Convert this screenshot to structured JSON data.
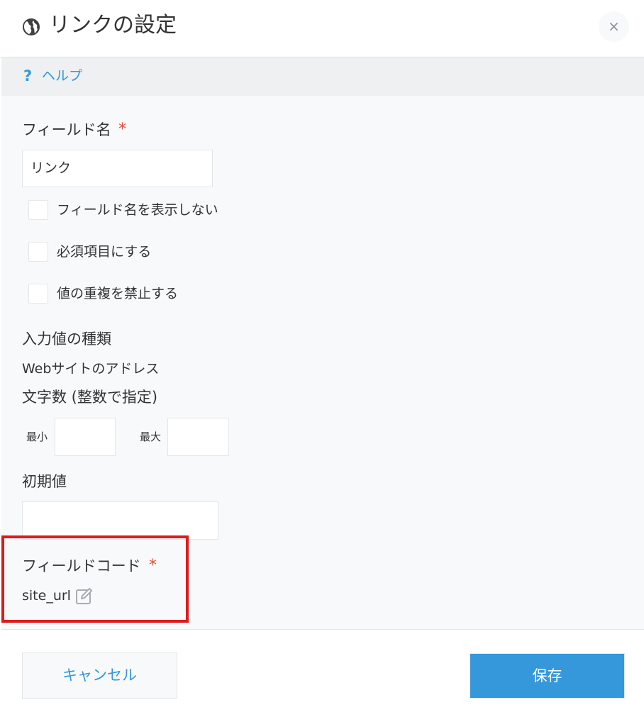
{
  "dialog": {
    "title": "リンクの設定",
    "close_label": "×",
    "globe_icon": "globe-icon"
  },
  "help": {
    "icon": "?",
    "label": "ヘルプ"
  },
  "form": {
    "field_name": {
      "label": "フィールド名",
      "required_mark": "*",
      "value": "リンク"
    },
    "options": [
      {
        "label": "フィールド名を表示しない",
        "checked": false
      },
      {
        "label": "必須項目にする",
        "checked": false
      },
      {
        "label": "値の重複を禁止する",
        "checked": false
      }
    ],
    "input_type": {
      "label": "入力値の種類",
      "value": "Webサイトのアドレス"
    },
    "char_count": {
      "label": "文字数 (整数で指定)",
      "min_label": "最小",
      "max_label": "最大",
      "min_value": "",
      "max_value": ""
    },
    "default_value": {
      "label": "初期値",
      "value": ""
    },
    "field_code": {
      "label": "フィールドコード",
      "required_mark": "*",
      "value": "site_url",
      "edit_icon": "pencil-icon"
    }
  },
  "footer": {
    "cancel_label": "キャンセル",
    "save_label": "保存"
  },
  "colors": {
    "accent": "#3498db",
    "required": "#e74c3c",
    "highlight": "#e0191b",
    "panel_bg": "#f7f9fa"
  }
}
